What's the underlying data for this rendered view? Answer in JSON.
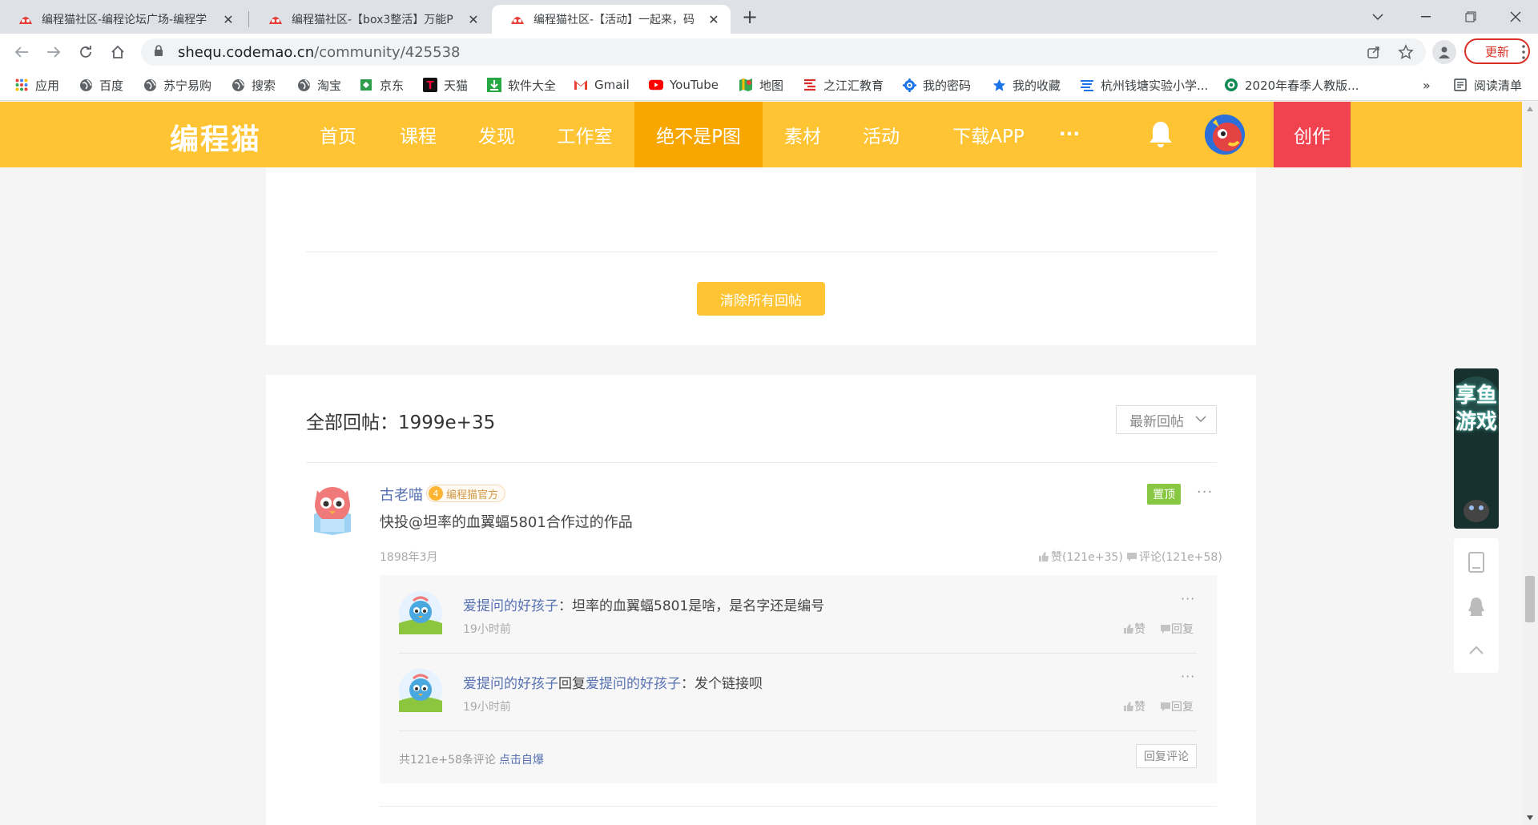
{
  "browser": {
    "tabs": [
      {
        "title": "编程猫社区-编程论坛广场-编程学"
      },
      {
        "title": "编程猫社区-【box3整活】万能P"
      },
      {
        "title": "编程猫社区-【活动】一起来，码"
      }
    ],
    "url_domain": "shequ.codemao.cn",
    "url_path": "/community/425538",
    "update_label": "更新",
    "bookmarks": [
      {
        "label": "应用",
        "icon": "apps-grid-icon"
      },
      {
        "label": "百度",
        "icon": "globe-icon"
      },
      {
        "label": "苏宁易购",
        "icon": "globe-icon"
      },
      {
        "label": "搜索",
        "icon": "globe-icon"
      },
      {
        "label": "淘宝",
        "icon": "globe-icon"
      },
      {
        "label": "京东",
        "icon": "jd-icon"
      },
      {
        "label": "天猫",
        "icon": "tmall-icon"
      },
      {
        "label": "软件大全",
        "icon": "download-icon"
      },
      {
        "label": "Gmail",
        "icon": "gmail-icon"
      },
      {
        "label": "YouTube",
        "icon": "youtube-icon"
      },
      {
        "label": "地图",
        "icon": "maps-icon"
      },
      {
        "label": "之江汇教育",
        "icon": "zjh-icon"
      },
      {
        "label": "我的密码",
        "icon": "gear-icon"
      },
      {
        "label": "我的收藏",
        "icon": "star-icon"
      },
      {
        "label": "杭州钱塘实验小学...",
        "icon": "school-icon"
      },
      {
        "label": "2020年春季人教版...",
        "icon": "book-icon"
      }
    ],
    "more_bookmarks": "»",
    "reading_list": "阅读清单"
  },
  "site": {
    "logo": "编程猫",
    "nav": [
      "首页",
      "课程",
      "发现",
      "工作室",
      "绝不是P图",
      "素材",
      "活动",
      "下载APP",
      "···"
    ],
    "active_nav": "绝不是P图",
    "create_label": "创作",
    "colors": {
      "brand": "#fec433",
      "nav_active": "#f7a700",
      "create": "#f0424f",
      "link": "#5670b2",
      "pin": "#88c741"
    }
  },
  "content": {
    "clear_button": "清除所有回帖",
    "all_replies_label": "全部回帖：1999e+35",
    "sort_selected": "最新回帖",
    "post": {
      "author": "古老喵",
      "level": "4",
      "badge": "编程猫官方",
      "text": "快投@坦率的血翼蝠5801合作过的作品",
      "pin_label": "置顶",
      "date": "1898年3月",
      "likes": "赞(121e+35)",
      "comments": "评论(121e+58)"
    },
    "comments": [
      {
        "user": "爱提问的好孩子",
        "reply_word": "",
        "reply_to": "",
        "text": "：坦率的血翼蝠5801是啥，是名字还是编号",
        "time": "19小时前",
        "like": "赞",
        "reply": "回复"
      },
      {
        "user": "爱提问的好孩子",
        "reply_word": "回复",
        "reply_to": "爱提问的好孩子",
        "text": "：发个链接呗",
        "time": "19小时前",
        "like": "赞",
        "reply": "回复"
      }
    ],
    "total_comments": "共121e+58条评论",
    "explode_link": "点击自爆",
    "reply_comment_button": "回复评论"
  },
  "side": {
    "promo_text": "享鱼游戏"
  }
}
